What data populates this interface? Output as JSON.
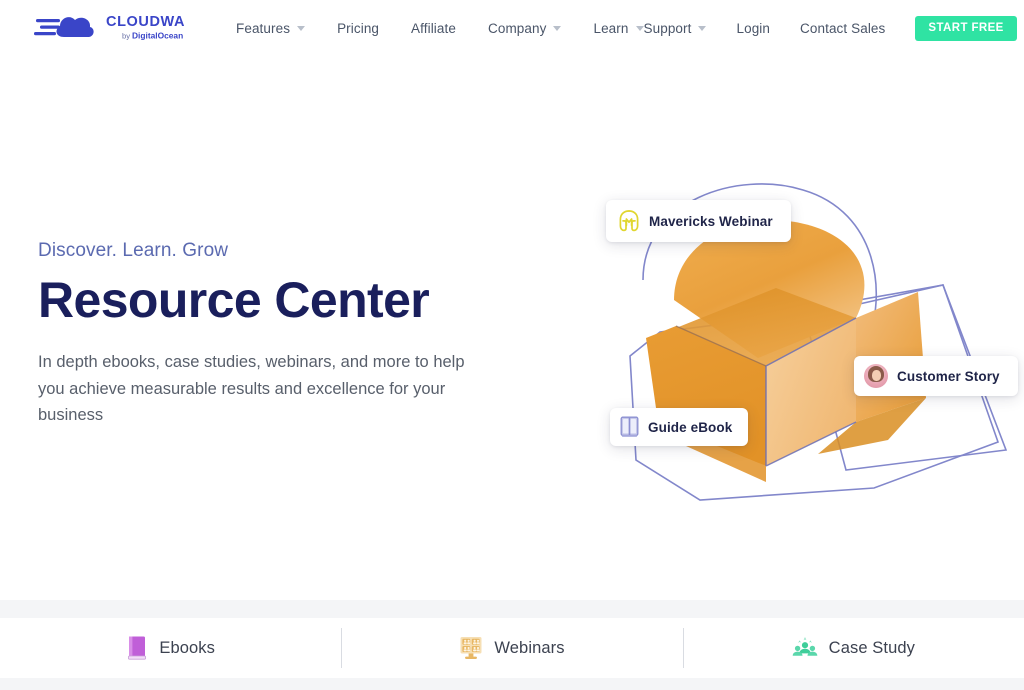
{
  "brand": {
    "name": "CLOUDWAYS",
    "tagline": "by DigitalOcean",
    "logo_icon": "cloud-speed-icon",
    "logo_color": "#3a45c8"
  },
  "header": {
    "nav_main": [
      {
        "label": "Features",
        "has_caret": true,
        "icon": "chevron-down-icon"
      },
      {
        "label": "Pricing",
        "has_caret": false
      },
      {
        "label": "Affiliate",
        "has_caret": false
      },
      {
        "label": "Company",
        "has_caret": true,
        "icon": "chevron-down-icon"
      },
      {
        "label": "Learn",
        "has_caret": true,
        "icon": "chevron-down-icon"
      }
    ],
    "nav_right": [
      {
        "label": "Support",
        "has_caret": true,
        "icon": "chevron-down-icon"
      },
      {
        "label": "Login",
        "has_caret": false
      },
      {
        "label": "Contact Sales",
        "has_caret": false
      }
    ],
    "cta": {
      "label": "START FREE",
      "color": "#2fe3a3"
    }
  },
  "hero": {
    "eyebrow": "Discover. Learn. Grow",
    "title": "Resource Center",
    "description": "In depth ebooks, case studies, webinars, and more to help you achieve measurable results and excellence for your business",
    "eyebrow_color": "#5b6ab0",
    "title_color": "#1a1f5c",
    "description_color": "#585f6b"
  },
  "illustration": {
    "name": "open-box-3d-illustration",
    "box_color": "#e89a33",
    "wireframe_color": "#7a7fc4",
    "cards": [
      {
        "label": "Mavericks Webinar",
        "icon": "mavericks-helmet-icon",
        "icon_color": "#e3d93a"
      },
      {
        "label": "Customer Story",
        "icon": "avatar-icon",
        "icon_color": "#e8a3b2"
      },
      {
        "label": "Guide eBook",
        "icon": "open-book-icon",
        "icon_color": "#8b8fd1"
      }
    ]
  },
  "tabs": [
    {
      "label": "Ebooks",
      "icon": "purple-book-icon",
      "icon_color": "#c05fd8"
    },
    {
      "label": "Webinars",
      "icon": "webinar-grid-icon",
      "icon_color": "#e8b763"
    },
    {
      "label": "Case Study",
      "icon": "people-group-icon",
      "icon_color": "#3fce9a"
    }
  ]
}
